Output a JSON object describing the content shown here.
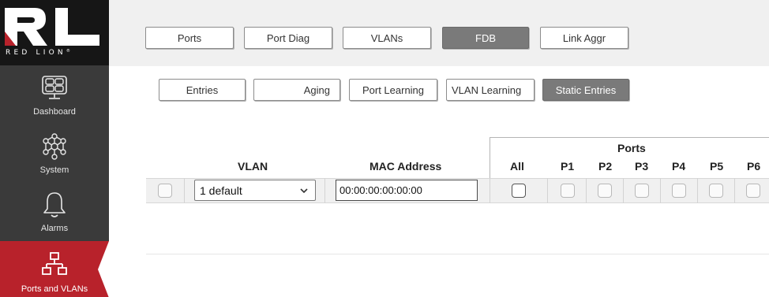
{
  "brand": {
    "name": "RED LION"
  },
  "sidebar": {
    "items": [
      {
        "label": "Dashboard",
        "icon": "dashboard-grid-icon"
      },
      {
        "label": "System",
        "icon": "system-nodes-icon"
      },
      {
        "label": "Alarms",
        "icon": "bell-icon"
      },
      {
        "label": "Ports and VLANs",
        "icon": "network-icon",
        "active": true
      }
    ]
  },
  "top_tabs": [
    {
      "label": "Ports"
    },
    {
      "label": "Port Diag"
    },
    {
      "label": "VLANs"
    },
    {
      "label": "FDB",
      "selected": true
    },
    {
      "label": "Link Aggr"
    }
  ],
  "sub_tabs": [
    {
      "label": "Entries"
    },
    {
      "label": "Aging"
    },
    {
      "label": "Port Learning"
    },
    {
      "label": "VLAN Learning"
    },
    {
      "label": "Static Entries",
      "selected": true
    }
  ],
  "table": {
    "ports_group_label": "Ports",
    "columns": {
      "vlan": "VLAN",
      "mac": "MAC Address",
      "all": "All",
      "ports": [
        "P1",
        "P2",
        "P3",
        "P4",
        "P5",
        "P6"
      ]
    },
    "row": {
      "vlan_value": "1 default",
      "mac_value": "00:00:00:00:00:00"
    }
  },
  "colors": {
    "sidebar_bg": "#3a3a3a",
    "accent_red": "#b8222b",
    "selected_tab": "#7a7a7a",
    "topbar_bg": "#f0f0f0"
  }
}
